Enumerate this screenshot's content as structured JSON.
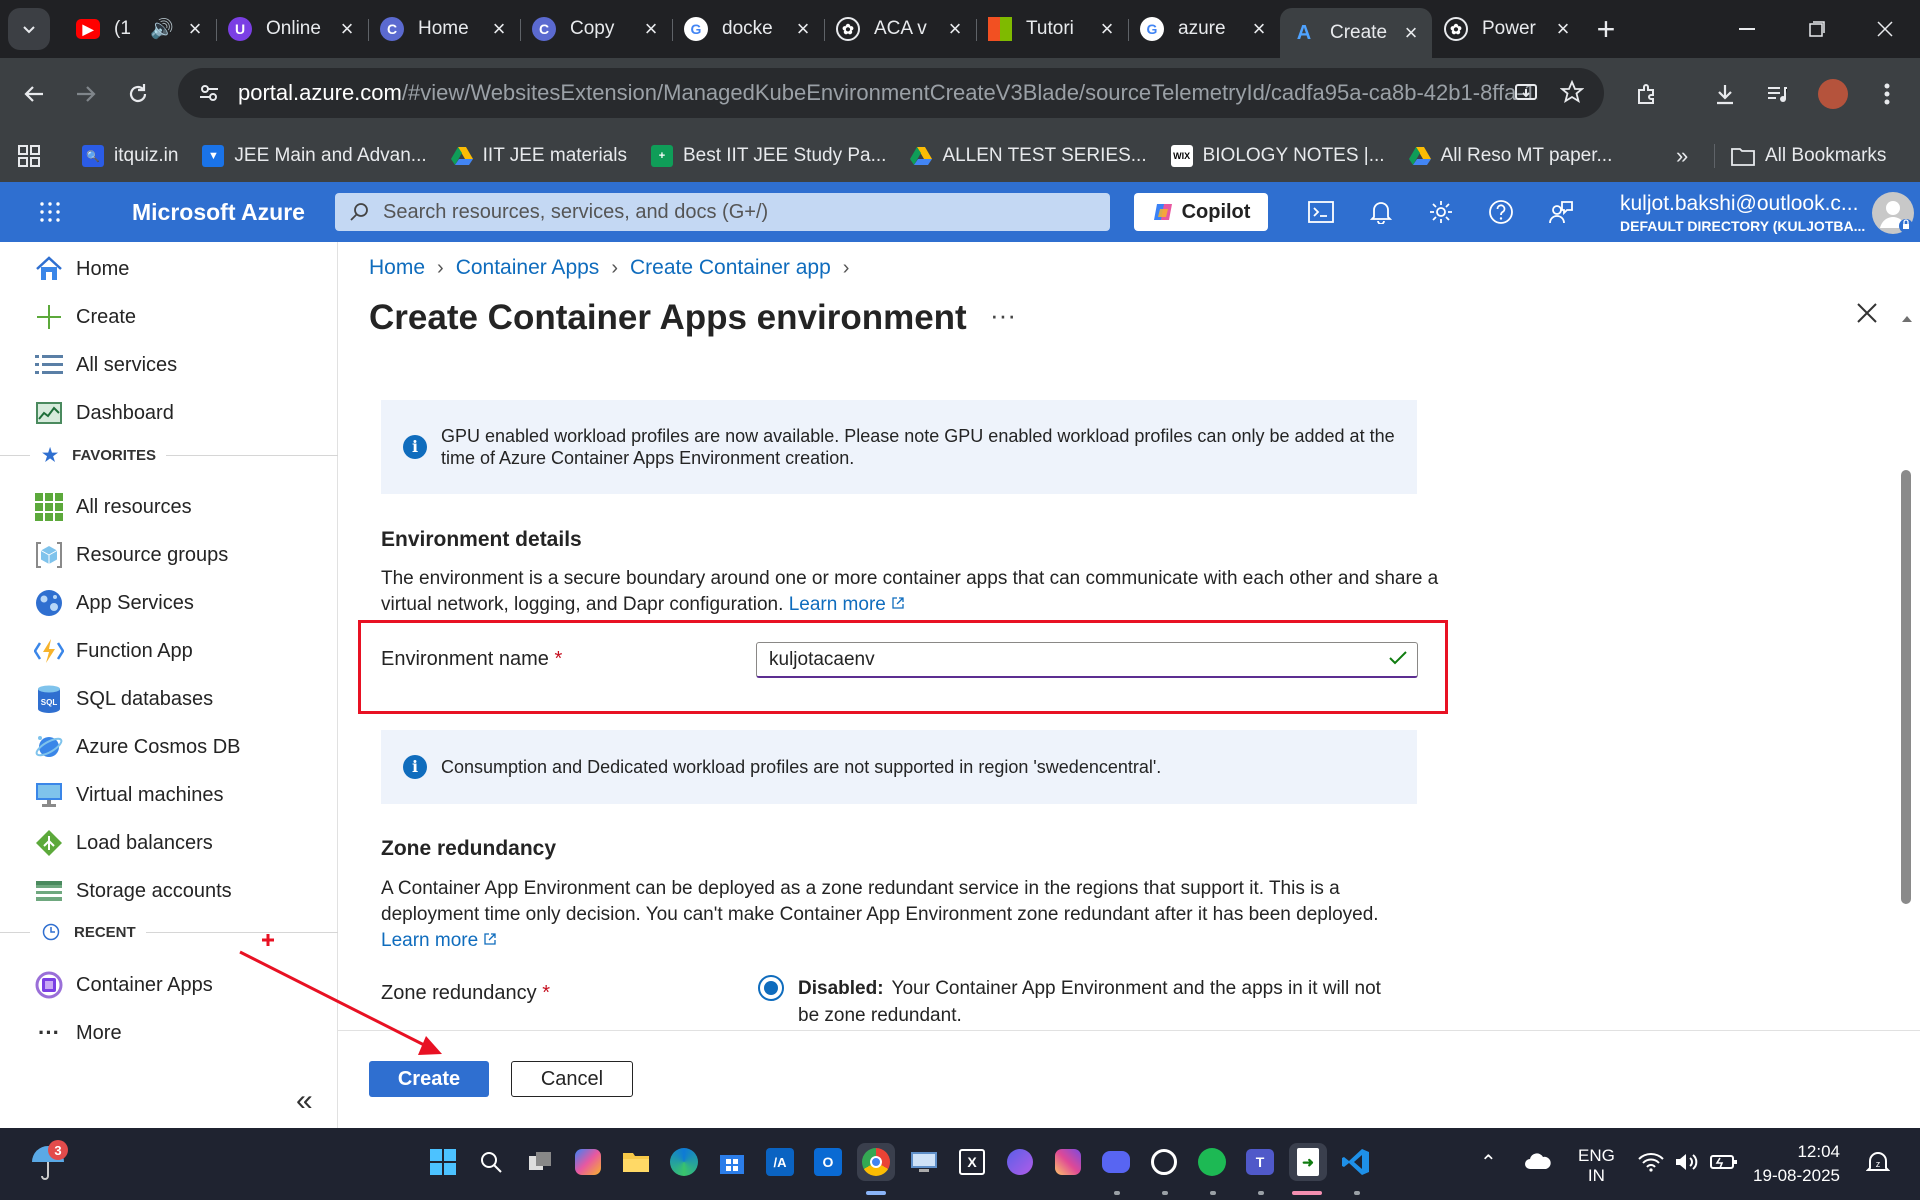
{
  "browser": {
    "tabs": [
      {
        "title": "(1",
        "icon": "youtube-icon",
        "color": "#ff0000"
      },
      {
        "title": "Online",
        "icon": "site-icon",
        "color": "#7b3fe4"
      },
      {
        "title": "Home",
        "icon": "copilot-c-icon",
        "color": "#6b6bd6"
      },
      {
        "title": "Copy",
        "icon": "copilot-c-icon",
        "color": "#6b6bd6"
      },
      {
        "title": "docke",
        "icon": "google-icon",
        "color": "#ffffff"
      },
      {
        "title": "ACA v",
        "icon": "openai-icon",
        "color": "#202124"
      },
      {
        "title": "Tutori",
        "icon": "microsoft-icon",
        "color": "#f25022"
      },
      {
        "title": "azure",
        "icon": "google-icon",
        "color": "#ffffff"
      },
      {
        "title": "Create",
        "icon": "azure-icon",
        "color": "#3c4043"
      },
      {
        "title": "Power",
        "icon": "openai-icon",
        "color": "#202124"
      }
    ],
    "url_host": "portal.azure.com",
    "url_path": "/#view/WebsitesExtension/ManagedKubeEnvironmentCreateV3Blade/sourceTelemetryId/cadfa95a-ca8b-42b1-8ffa-1...",
    "bookmarks": [
      {
        "label": "itquiz.in",
        "color": "#2b5ce6"
      },
      {
        "label": "JEE Main and Advan...",
        "color": "#1a73e8"
      },
      {
        "label": "IIT JEE materials",
        "color": "#fbbc04"
      },
      {
        "label": "Best IIT JEE Study Pa...",
        "color": "#0f9d58"
      },
      {
        "label": "ALLEN TEST SERIES...",
        "color": "#fbbc04"
      },
      {
        "label": "BIOLOGY NOTES |...",
        "color": "#ffffff"
      },
      {
        "label": "All Reso MT paper...",
        "color": "#fbbc04"
      }
    ],
    "all_bookmarks_label": "All Bookmarks"
  },
  "azure": {
    "brand": "Microsoft Azure",
    "search_placeholder": "Search resources, services, and docs (G+/)",
    "copilot_label": "Copilot",
    "account_email": "kuljot.bakshi@outlook.c...",
    "account_directory": "DEFAULT DIRECTORY (KULJOTBA..."
  },
  "sidebar": {
    "items": [
      {
        "label": "Home"
      },
      {
        "label": "Create"
      },
      {
        "label": "All services"
      },
      {
        "label": "Dashboard"
      }
    ],
    "favorites_label": "FAVORITES",
    "favorites": [
      {
        "label": "All resources"
      },
      {
        "label": "Resource groups"
      },
      {
        "label": "App Services"
      },
      {
        "label": "Function App"
      },
      {
        "label": "SQL databases"
      },
      {
        "label": "Azure Cosmos DB"
      },
      {
        "label": "Virtual machines"
      },
      {
        "label": "Load balancers"
      },
      {
        "label": "Storage accounts"
      }
    ],
    "recent_label": "RECENT",
    "recent": [
      {
        "label": "Container Apps"
      }
    ],
    "more_label": "More"
  },
  "main": {
    "breadcrumb": [
      "Home",
      "Container Apps",
      "Create Container app"
    ],
    "title": "Create Container Apps environment",
    "gpu_notice": "GPU enabled workload profiles are now available. Please note GPU enabled workload profiles can only be added at the time of Azure Container Apps Environment creation.",
    "env_details_heading": "Environment details",
    "env_details_text": "The environment is a secure boundary around one or more container apps that can communicate with each other and share a virtual network, logging, and Dapr configuration.",
    "learn_more": "Learn more",
    "env_name_label": "Environment name",
    "env_name_value": "kuljotacaenv",
    "region_notice": "Consumption and Dedicated workload profiles are not supported in region 'swedencentral'.",
    "zone_heading": "Zone redundancy",
    "zone_text": "A Container App Environment can be deployed as a zone redundant service in the regions that support it. This is a deployment time only decision. You can't make Container App Environment zone redundant after it has been deployed.",
    "zone_label": "Zone redundancy",
    "zone_option_bold": "Disabled:",
    "zone_option_text": "Your Container App Environment and the apps in it will not be zone redundant.",
    "required_mark": "*",
    "create_label": "Create",
    "cancel_label": "Cancel"
  },
  "taskbar": {
    "weather_badge": "3",
    "lang_line1": "ENG",
    "lang_line2": "IN",
    "time": "12:04",
    "date": "19-08-2025"
  },
  "colors": {
    "azure_header": "#2f6fd0",
    "link": "#0f6cbd",
    "annotation_red": "#e81123"
  }
}
